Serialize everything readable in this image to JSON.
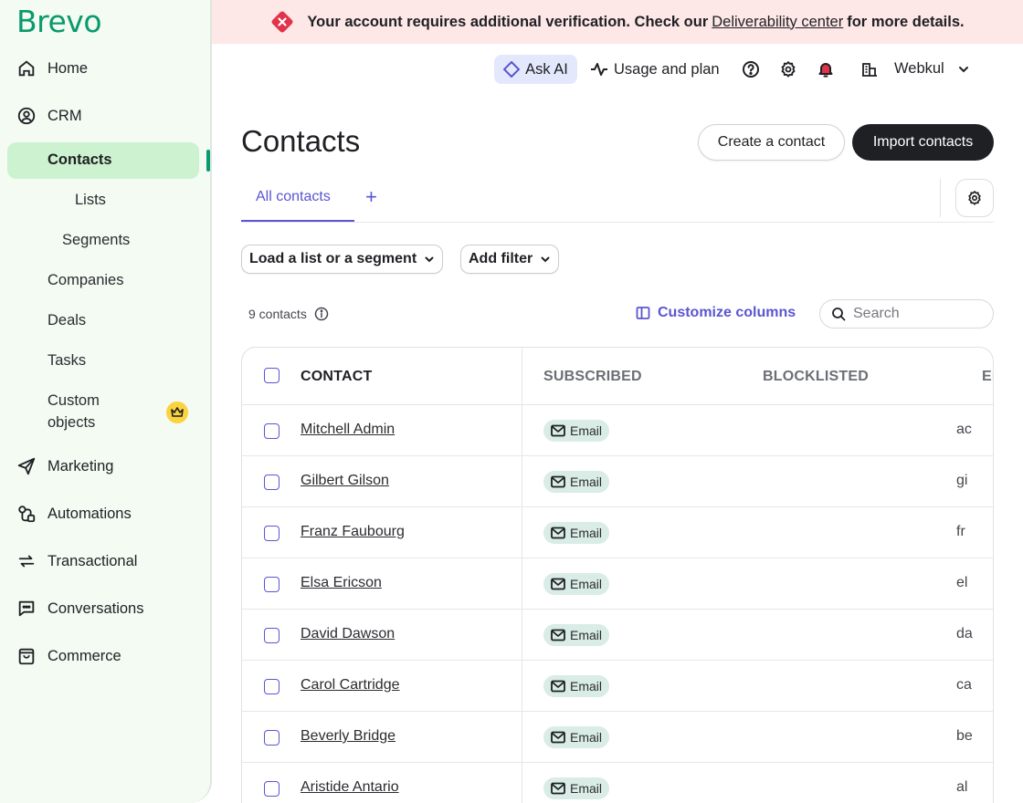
{
  "sidebar": {
    "logo": "Brevo",
    "items": {
      "home": "Home",
      "crm": "CRM",
      "contacts": "Contacts",
      "lists": "Lists",
      "segments": "Segments",
      "companies": "Companies",
      "deals": "Deals",
      "tasks": "Tasks",
      "custom_objects_1": "Custom",
      "custom_objects_2": "objects",
      "marketing": "Marketing",
      "automations": "Automations",
      "transactional": "Transactional",
      "conversations": "Conversations",
      "commerce": "Commerce"
    }
  },
  "banner": {
    "text_before": "Your account requires additional verification. Check our",
    "link": "Deliverability center",
    "text_after": "for more details."
  },
  "topbar": {
    "ask_ai": "Ask AI",
    "usage": "Usage and plan",
    "account": "Webkul"
  },
  "page": {
    "title": "Contacts",
    "create_button": "Create a contact",
    "import_button": "Import contacts",
    "tab_all": "All contacts",
    "tab_add": "+",
    "load_filter": "Load a list or a segment",
    "add_filter": "Add filter",
    "count": "9 contacts",
    "customize": "Customize columns",
    "search_placeholder": "Search"
  },
  "table": {
    "headers": {
      "contact": "CONTACT",
      "subscribed": "SUBSCRIBED",
      "blocklisted": "BLOCKLISTED",
      "email_cut": "EI"
    },
    "rows": [
      {
        "name": "Mitchell Admin",
        "badge": "Email",
        "email_cut": "ac"
      },
      {
        "name": "Gilbert Gilson",
        "badge": "Email",
        "email_cut": "gi"
      },
      {
        "name": "Franz Faubourg",
        "badge": "Email",
        "email_cut": "fr"
      },
      {
        "name": "Elsa Ericson",
        "badge": "Email",
        "email_cut": "el"
      },
      {
        "name": "David Dawson",
        "badge": "Email",
        "email_cut": "da"
      },
      {
        "name": "Carol Cartridge",
        "badge": "Email",
        "email_cut": "ca"
      },
      {
        "name": "Beverly Bridge",
        "badge": "Email",
        "email_cut": "be"
      },
      {
        "name": "Aristide Antario",
        "badge": "Email",
        "email_cut": "al"
      }
    ]
  },
  "colors": {
    "brand": "#0b996e",
    "accent": "#5a55d2",
    "sidebar_bg": "#f3fbf3",
    "banner_bg": "#fde7e7"
  }
}
